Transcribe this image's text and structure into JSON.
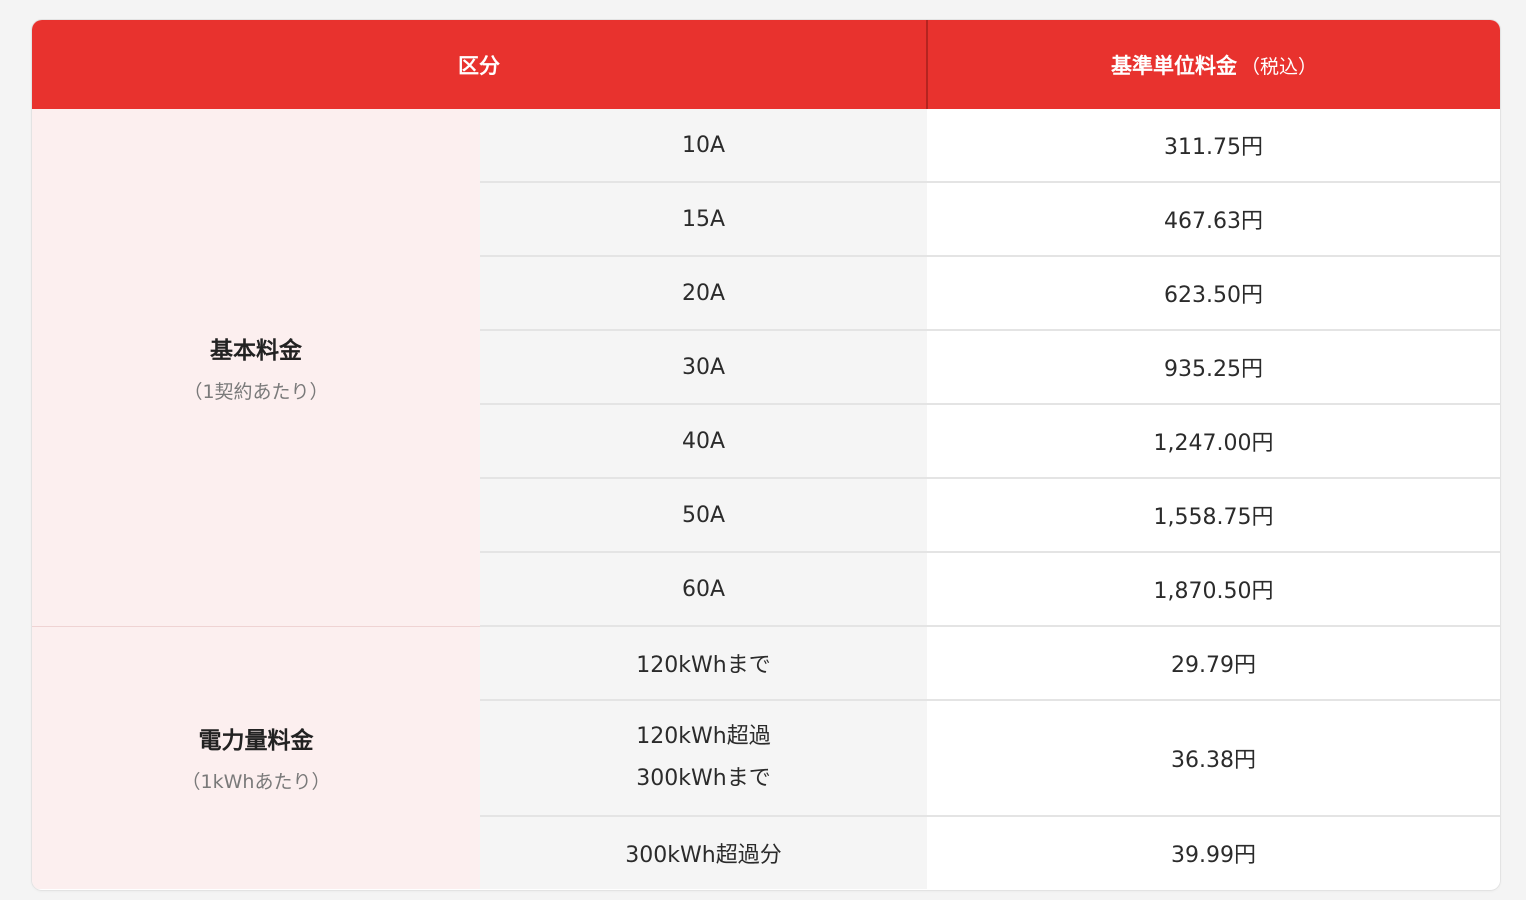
{
  "header": {
    "category": "区分",
    "price": "基準単位料金",
    "price_note": "（税込）"
  },
  "basic": {
    "title": "基本料金",
    "note": "（1契約あたり）",
    "rows": [
      {
        "size": "10A",
        "price": "311.75円"
      },
      {
        "size": "15A",
        "price": "467.63円"
      },
      {
        "size": "20A",
        "price": "623.50円"
      },
      {
        "size": "30A",
        "price": "935.25円"
      },
      {
        "size": "40A",
        "price": "1,247.00円"
      },
      {
        "size": "50A",
        "price": "1,558.75円"
      },
      {
        "size": "60A",
        "price": "1,870.50円"
      }
    ]
  },
  "energy": {
    "title": "電力量料金",
    "note": "（1kWhあたり）",
    "rows": [
      {
        "size": "120kWhまで",
        "price": "29.79円"
      },
      {
        "size_line1": "120kWh超過",
        "size_line2": "300kWhまで",
        "price": "36.38円"
      },
      {
        "size": "300kWh超過分",
        "price": "39.99円"
      }
    ]
  },
  "colors": {
    "header_bg": "#e8322e",
    "category_bg": "#fcefef",
    "size_bg": "#f5f5f5"
  }
}
